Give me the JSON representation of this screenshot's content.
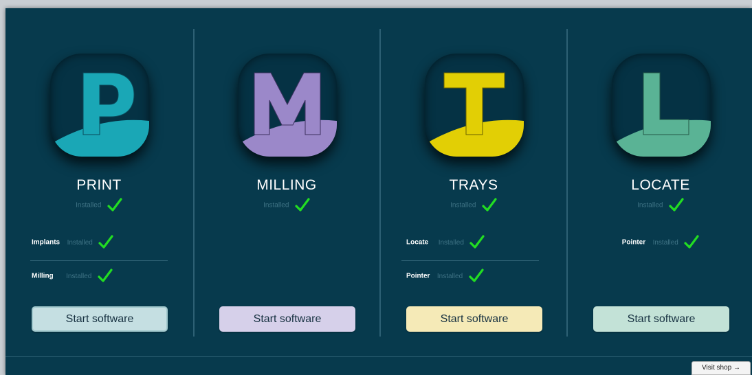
{
  "apps": [
    {
      "name": "PRINT",
      "letter": "P",
      "accent": "#1aa7b6",
      "button_color": "#c5dfe2",
      "status": "Installed",
      "modules": [
        {
          "name": "Implants",
          "status": "Installed"
        },
        {
          "name": "Milling",
          "status": "Installed"
        }
      ],
      "start_label": "Start software",
      "icon": "letter-p-icon"
    },
    {
      "name": "MILLING",
      "letter": "M",
      "accent": "#9b88c9",
      "button_color": "#d6d0ea",
      "status": "Installed",
      "modules": [],
      "start_label": "Start software",
      "icon": "letter-m-icon"
    },
    {
      "name": "TRAYS",
      "letter": "T",
      "accent": "#e2cf05",
      "button_color": "#f5eab7",
      "status": "Installed",
      "modules": [
        {
          "name": "Locate",
          "status": "Installed"
        },
        {
          "name": "Pointer",
          "status": "Installed"
        }
      ],
      "start_label": "Start software",
      "icon": "letter-t-icon"
    },
    {
      "name": "LOCATE",
      "letter": "L",
      "accent": "#5ab395",
      "button_color": "#c3e2d7",
      "status": "Installed",
      "modules": [
        {
          "name": "Pointer",
          "status": "Installed"
        }
      ],
      "start_label": "Start software",
      "icon": "letter-l-icon"
    }
  ],
  "footer": {
    "visit_shop_label": "Visit shop →"
  },
  "colors": {
    "background": "#073a4d",
    "check": "#22dd22"
  }
}
